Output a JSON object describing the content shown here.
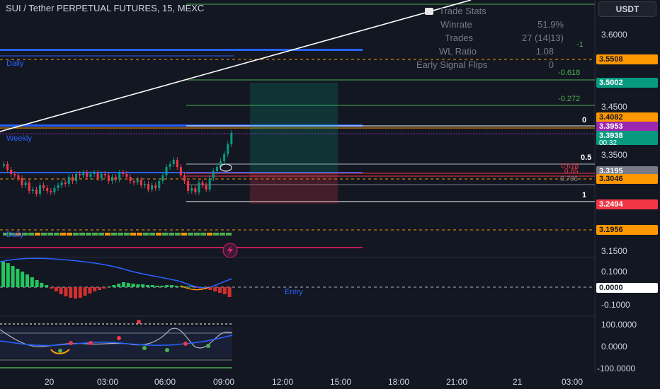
{
  "header": {
    "title": "SUI / Tether PERPETUAL FUTURES, 15, MEXC",
    "currency_button": "USDT"
  },
  "trade_stats": {
    "title": "Trade Stats",
    "rows": [
      {
        "label": "Winrate",
        "value": "51.9%"
      },
      {
        "label": "Trades",
        "value": "27 (14|13)"
      },
      {
        "label": "WL Ratio",
        "value": "1.08"
      },
      {
        "label": "Early Signal Flips",
        "value": "0"
      }
    ]
  },
  "level_labels": {
    "daily_top": "Daily",
    "weekly": "Weekly",
    "daily_low": "Daily",
    "entry": "Entry",
    "fib_neg1": "-1",
    "fib_neg0618": "-0.618",
    "fib_neg0272": "-0.272",
    "fib_0": "0",
    "fib_05": "0.5",
    "fib_0618": "0.618",
    "fib_065": "0.65",
    "fib_0786": "0.786",
    "fib_1": "1"
  },
  "price_axis": {
    "ticks": [
      "3.6000",
      "3.4500",
      "3.3500",
      "3.1500"
    ],
    "tags": [
      {
        "text": "3.5508",
        "color": "#ff9800"
      },
      {
        "text": "3.5002",
        "color": "#089981"
      },
      {
        "text": "3.4082",
        "color": "#ff9800"
      },
      {
        "text": "3.3953",
        "color": "#9c27b0"
      },
      {
        "text": "3.3938",
        "text2": "00:32",
        "color": "#089981"
      },
      {
        "text": "3.3195",
        "color": "#787b86"
      },
      {
        "text": "3.3046",
        "color": "#ff9800"
      },
      {
        "text": "3.2494",
        "color": "#f23645"
      },
      {
        "text": "3.1956",
        "color": "#ff9800"
      }
    ]
  },
  "macd_axis": {
    "ticks": [
      "0.1000",
      "-0.1000"
    ],
    "tag": "0.0000"
  },
  "osc_axis": {
    "ticks": [
      "100.0000",
      "0.0000",
      "-100.0000"
    ]
  },
  "time_axis": {
    "ticks": [
      "20",
      "03:00",
      "06:00",
      "09:00",
      "12:00",
      "15:00",
      "18:00",
      "21:00",
      "21",
      "03:00"
    ]
  },
  "colors": {
    "background": "#131722",
    "up": "#089981",
    "down": "#f23645",
    "level_blue": "#2962ff",
    "accent_orange": "#ff9800",
    "accent_purple": "#9c27b0"
  }
}
